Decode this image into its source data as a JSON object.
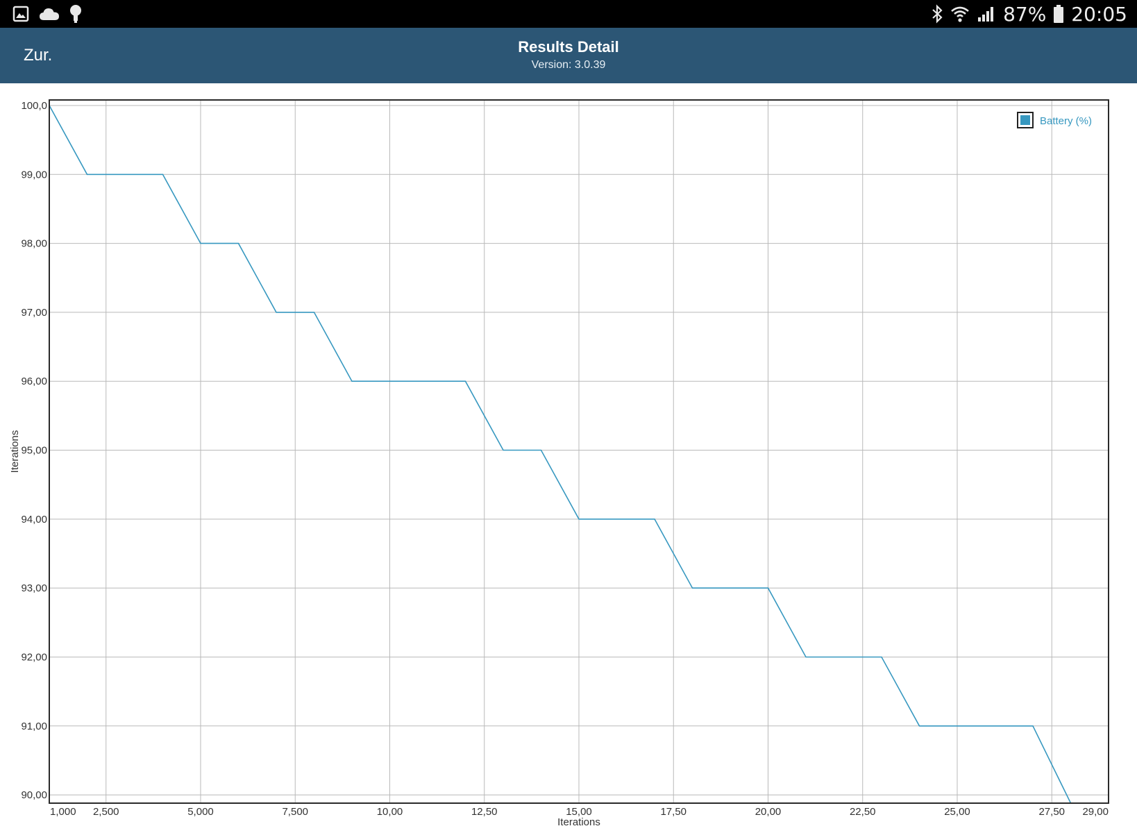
{
  "status_bar": {
    "left_icons": [
      "gallery-icon",
      "cloud-icon",
      "lightbulb-icon"
    ],
    "right_icons": [
      "bluetooth-icon",
      "wifi-icon",
      "signal-icon",
      "battery-icon"
    ],
    "battery_text": "87%",
    "time": "20:05"
  },
  "app_bar": {
    "back_label": "Zur.",
    "title": "Results Detail",
    "version": "Version: 3.0.39"
  },
  "colors": {
    "app_bar": "#2c5675",
    "series": "#3798c0",
    "grid": "#b9b9b9"
  },
  "chart_data": {
    "type": "line",
    "xlabel": "Iterations",
    "ylabel": "Iterations",
    "xlim": [
      1000,
      29000
    ],
    "ylim": [
      89.88,
      100.08
    ],
    "x_ticks": [
      1000,
      2500,
      5000,
      7500,
      10000,
      12500,
      15000,
      17500,
      20000,
      22500,
      25000,
      27500,
      29000
    ],
    "x_tick_labels": [
      "1,000",
      "2,500",
      "5,000",
      "7,500",
      "10,00",
      "12,50",
      "15,00",
      "17,50",
      "20,00",
      "22,50",
      "25,00",
      "27,50",
      "29,00"
    ],
    "y_ticks": [
      90,
      91,
      92,
      93,
      94,
      95,
      96,
      97,
      98,
      99,
      100
    ],
    "y_tick_labels": [
      "90,00",
      "91,00",
      "92,00",
      "93,00",
      "94,00",
      "95,00",
      "96,00",
      "97,00",
      "98,00",
      "99,00",
      "100,0"
    ],
    "grid": true,
    "legend": "top-right",
    "series": [
      {
        "name": "Battery (%)",
        "x": [
          1000,
          2000,
          4000,
          5000,
          6000,
          7000,
          8000,
          9000,
          12000,
          13000,
          14000,
          15000,
          17000,
          18000,
          20000,
          21000,
          23000,
          24000,
          27000,
          28000,
          29000
        ],
        "y": [
          100,
          99,
          99,
          98,
          98,
          97,
          97,
          96,
          96,
          95,
          95,
          94,
          94,
          93,
          93,
          92,
          92,
          91,
          91,
          89.88,
          89.88
        ]
      }
    ]
  }
}
